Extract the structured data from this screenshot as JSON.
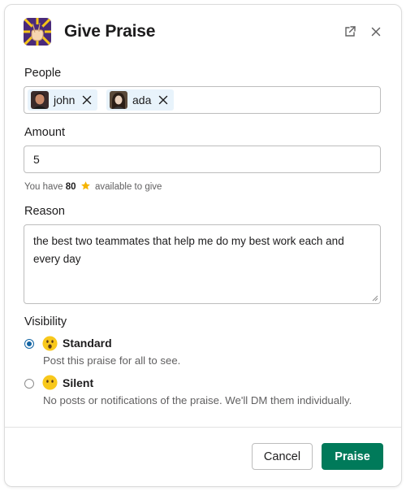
{
  "dialog": {
    "title": "Give Praise",
    "icons": {
      "app": "peace-hand-icon",
      "open": "open-in-new-window-icon",
      "close": "close-icon"
    }
  },
  "people": {
    "label": "People",
    "chips": [
      {
        "name": "john",
        "avatar": "avatar-john"
      },
      {
        "name": "ada",
        "avatar": "avatar-ada"
      }
    ]
  },
  "amount": {
    "label": "Amount",
    "value": "5",
    "hint_prefix": "You have",
    "hint_count": "80",
    "hint_suffix": "available to give"
  },
  "reason": {
    "label": "Reason",
    "value": "the best two teammates that help me do my best work each and every day"
  },
  "visibility": {
    "label": "Visibility",
    "options": [
      {
        "title": "Standard",
        "description": "Post this praise for all to see.",
        "selected": true,
        "emoji": "surprised-face-icon"
      },
      {
        "title": "Silent",
        "description": "No posts or notifications of the praise. We'll DM them individually.",
        "selected": false,
        "emoji": "no-mouth-face-icon"
      }
    ]
  },
  "footer": {
    "cancel_label": "Cancel",
    "submit_label": "Praise"
  },
  "colors": {
    "primary": "#007a5a",
    "chip_bg": "#e8f3fb",
    "radio_selected": "#1264a3"
  }
}
